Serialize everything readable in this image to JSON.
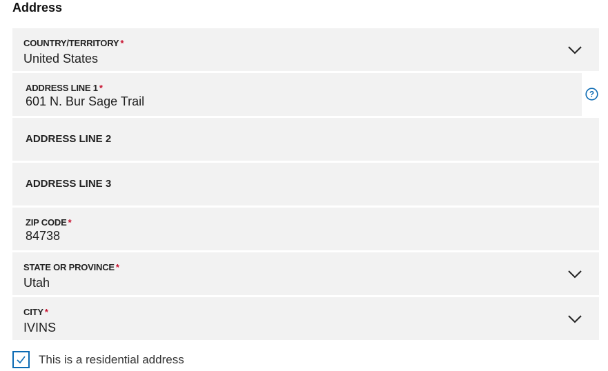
{
  "section": {
    "title": "Address"
  },
  "fields": {
    "country": {
      "label": "COUNTRY/TERRITORY",
      "required": "*",
      "value": "United States"
    },
    "address1": {
      "label": "ADDRESS LINE 1",
      "required": "*",
      "value": "601 N. Bur Sage Trail"
    },
    "address2": {
      "label": "ADDRESS LINE 2"
    },
    "address3": {
      "label": "ADDRESS LINE 3"
    },
    "zip": {
      "label": "ZIP CODE",
      "required": "*",
      "value": "84738"
    },
    "state": {
      "label": "STATE OR PROVINCE",
      "required": "*",
      "value": "Utah"
    },
    "city": {
      "label": "CITY",
      "required": "*",
      "value": "IVINS"
    }
  },
  "residential": {
    "label": "This is a residential address",
    "checked": true
  },
  "icons": {
    "help": "help-circle-icon",
    "chevron": "chevron-down-icon",
    "check": "checkmark-icon"
  },
  "colors": {
    "field_bg": "#f2f2f2",
    "required": "#c8102e",
    "accent": "#0b6ab3"
  }
}
